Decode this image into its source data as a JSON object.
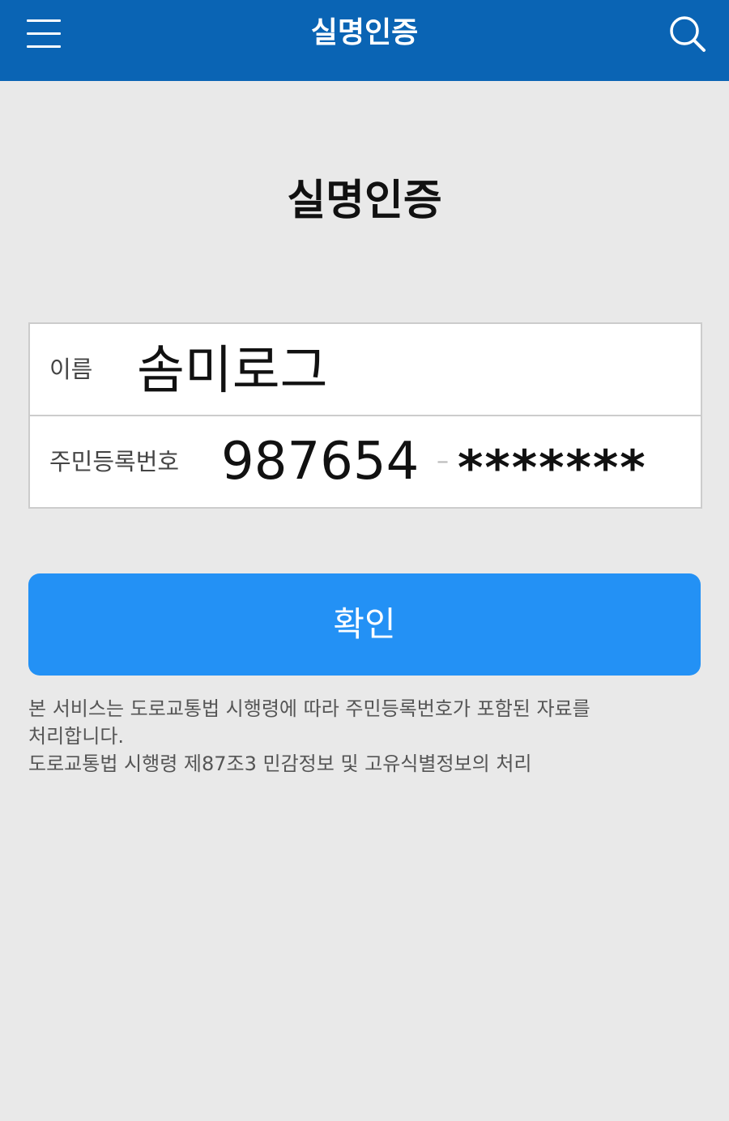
{
  "header": {
    "title": "실명인증",
    "menu_icon": "hamburger-menu-icon",
    "search_icon": "search-icon",
    "background_color": "#0a64b4"
  },
  "page": {
    "title": "실명인증"
  },
  "form": {
    "name": {
      "label": "이름",
      "value": "솜미로그"
    },
    "rrn": {
      "label": "주민등록번호",
      "front_value": "987654",
      "separator": "–",
      "back_value": "*******"
    }
  },
  "confirm_button": {
    "label": "확인",
    "color": "#2391f5"
  },
  "notice": {
    "line1": "본 서비스는 도로교통법 시행령에 따라 주민등록번호가 포함된 자료를",
    "line2": "처리합니다.",
    "line3": "도로교통법 시행령 제87조3 민감정보 및 고유식별정보의 처리"
  }
}
